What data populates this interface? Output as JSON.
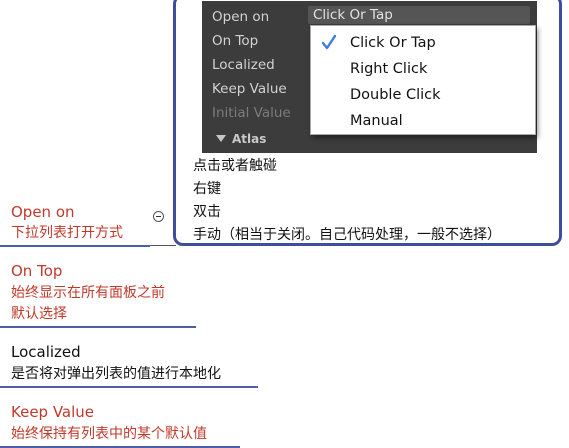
{
  "inspector": {
    "rows": [
      {
        "label": "Open on",
        "dim": false
      },
      {
        "label": "On Top",
        "dim": false
      },
      {
        "label": "Localized",
        "dim": false
      },
      {
        "label": "Keep Value",
        "dim": false
      },
      {
        "label": "Initial Value",
        "dim": true
      }
    ],
    "open_on_value": "Click Or Tap",
    "foldout": "Atlas"
  },
  "dropdown": {
    "items": [
      {
        "label": "Click Or Tap",
        "checked": true
      },
      {
        "label": "Right Click",
        "checked": false
      },
      {
        "label": "Double Click",
        "checked": false
      },
      {
        "label": "Manual",
        "checked": false
      }
    ],
    "check_icon": "checkmark-icon",
    "check_color": "#3b7ddd"
  },
  "descriptions": [
    "点击或者触碰",
    "右键",
    "双击",
    "手动（相当于关闭。自己代码处理，一般不选择）"
  ],
  "nodes": [
    {
      "title": "Open on",
      "lines": [
        "下拉列表打开方式"
      ],
      "color": "#c0392b"
    },
    {
      "title": "On Top",
      "lines": [
        "始终显示在所有面板之前",
        "默认选择"
      ],
      "color": "#c0392b"
    },
    {
      "title": "Localized",
      "lines": [
        "是否将对弹出列表的值进行本地化"
      ],
      "color": "#111111"
    },
    {
      "title": "Keep Value",
      "lines": [
        "始终保持有列表中的某个默认值"
      ],
      "color": "#c0392b"
    }
  ],
  "colors": {
    "accent_border": "#3e4e9c",
    "node_red": "#c0392b",
    "inspector_bg": "#3c3c3c"
  }
}
